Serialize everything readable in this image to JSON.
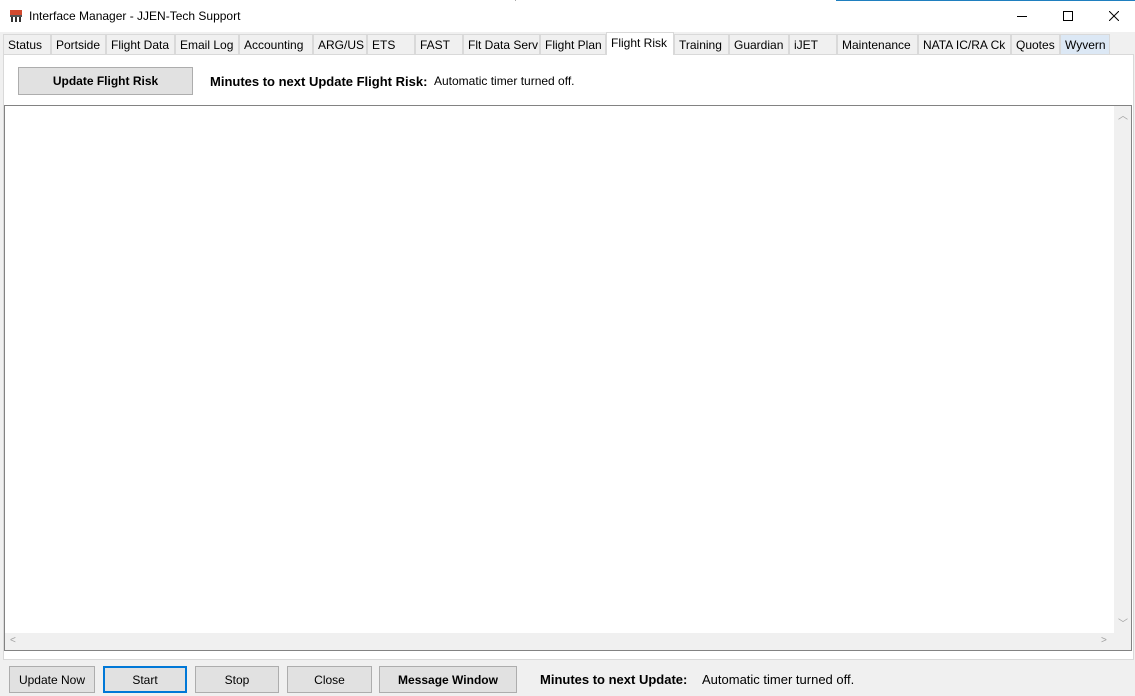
{
  "window": {
    "title": "Interface Manager - JJEN-Tech Support"
  },
  "tabs": [
    {
      "label": "Status"
    },
    {
      "label": "Portside"
    },
    {
      "label": "Flight Data"
    },
    {
      "label": "Email Log"
    },
    {
      "label": "Accounting"
    },
    {
      "label": "ARG/US"
    },
    {
      "label": "ETS"
    },
    {
      "label": "FAST"
    },
    {
      "label": "Flt Data Serv"
    },
    {
      "label": "Flight Plan"
    },
    {
      "label": "Flight Risk"
    },
    {
      "label": "Training"
    },
    {
      "label": "Guardian"
    },
    {
      "label": "iJET"
    },
    {
      "label": "Maintenance"
    },
    {
      "label": "NATA IC/RA Ck"
    },
    {
      "label": "Quotes"
    },
    {
      "label": "Wyvern"
    }
  ],
  "active_tab": "Flight Risk",
  "flight_risk_panel": {
    "update_button": "Update Flight Risk",
    "timer_label": "Minutes to next Update Flight Risk:",
    "timer_value": "Automatic timer turned off."
  },
  "bottom_bar": {
    "update_now": "Update Now",
    "start": "Start",
    "stop": "Stop",
    "close": "Close",
    "message_window": "Message Window",
    "timer_label": "Minutes to next Update:",
    "timer_value": "Automatic timer turned off."
  },
  "colors": {
    "accent": "#0078d7",
    "tab_highlight": "#dce8f5"
  }
}
